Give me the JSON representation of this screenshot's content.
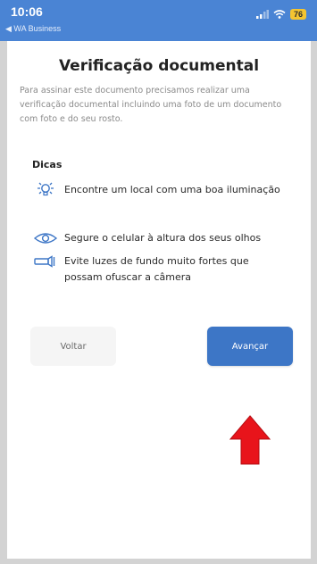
{
  "status_bar": {
    "time": "10:06",
    "back_app": "◀ WA Business",
    "battery": "76"
  },
  "page": {
    "title": "Verificação documental",
    "description": "Para assinar este documento precisamos realizar uma verificação documental incluindo uma foto de um documento com foto e do seu rosto."
  },
  "tips": {
    "heading": "Dicas",
    "items": [
      {
        "icon": "lightbulb-icon",
        "text": "Encontre um local com uma boa iluminação"
      },
      {
        "icon": "eye-icon",
        "text": "Segure o celular à altura dos seus olhos"
      },
      {
        "icon": "flashlight-icon",
        "text": "Evite luzes de fundo muito fortes que possam ofuscar a câmera"
      }
    ]
  },
  "buttons": {
    "back_label": "Voltar",
    "next_label": "Avançar"
  },
  "colors": {
    "status_bar": "#4a84d4",
    "primary_button": "#3d76c6",
    "annotation_arrow": "#e8141b"
  }
}
